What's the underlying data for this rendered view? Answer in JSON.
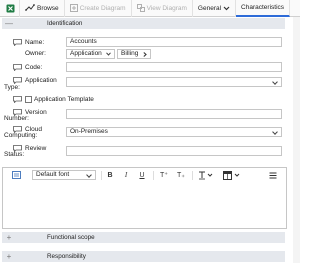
{
  "toolbar": {
    "browse_label": "Browse",
    "create_diagram_label": "Create Diagram",
    "view_diagram_label": "View Diagram",
    "general_label": "General",
    "characteristics_label": "Characteristics"
  },
  "sections": {
    "identification": "Identification",
    "functional_scope": "Functional scope",
    "responsibility": "Responsibility"
  },
  "form": {
    "name_label": "Name:",
    "name_value": "Accounts",
    "owner_label": "Owner:",
    "owner_type": "Application",
    "owner_value": "Billing",
    "code_label": "Code:",
    "code_value": "",
    "app_type_label_1": "Application",
    "app_type_label_2": "Type:",
    "app_type_value": "",
    "app_template_label": "Application Template",
    "version_label_1": "Version",
    "version_label_2": "Number:",
    "version_value": "",
    "cloud_label_1": "Cloud",
    "cloud_label_2": "Computing:",
    "cloud_value": "On-Premises",
    "review_label_1": "Review",
    "review_label_2": "Status:",
    "review_value": ""
  },
  "editor": {
    "font": "Default font",
    "bold": "B",
    "italic": "I",
    "underline": "U",
    "superscript": "T⁺",
    "subscript": "T₊"
  }
}
